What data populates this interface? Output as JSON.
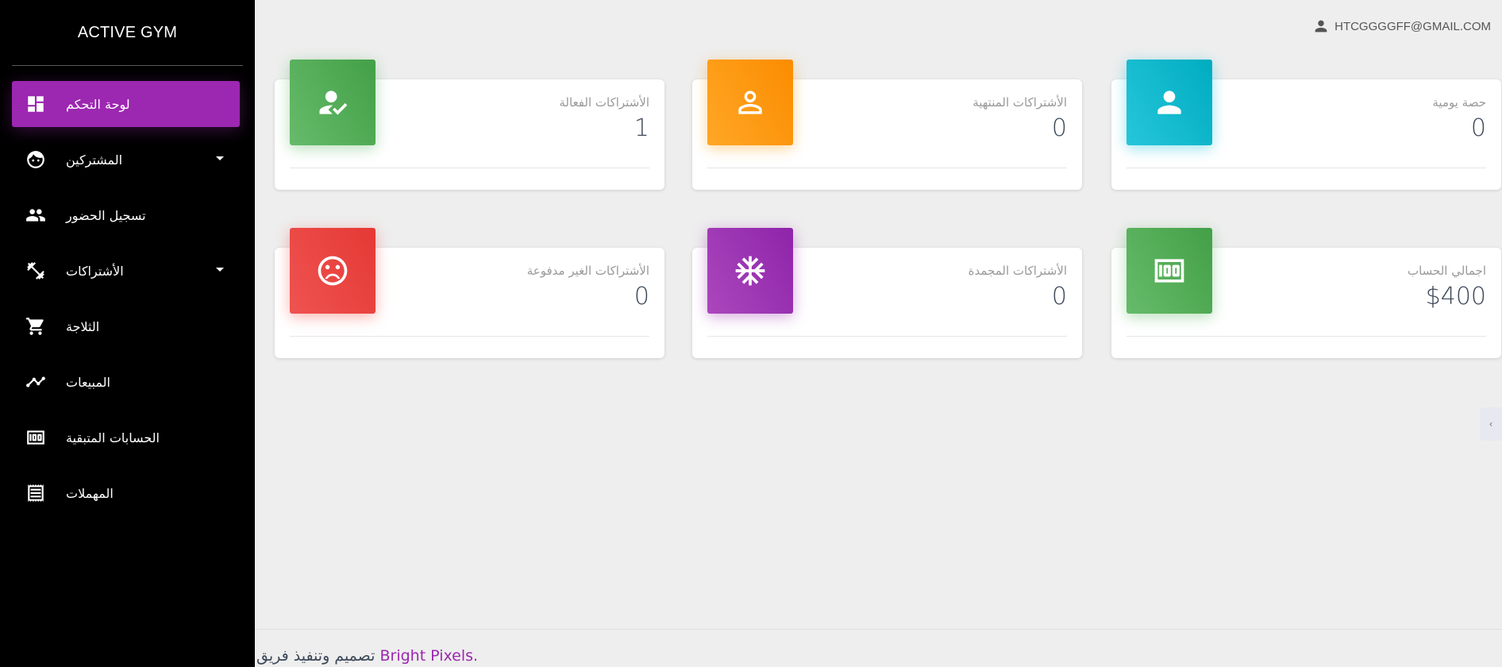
{
  "sidebar": {
    "brand": "ACTIVE GYM",
    "items": [
      {
        "label": "لوحة التحكم",
        "icon": "dashboard-icon"
      },
      {
        "label": "المشتركين",
        "icon": "face-icon"
      },
      {
        "label": "تسجيل الحضور",
        "icon": "people-icon"
      },
      {
        "label": "الأشتراكات",
        "icon": "dumbbell-icon"
      },
      {
        "label": "الثلاجة",
        "icon": "cart-icon"
      },
      {
        "label": "المبيعات",
        "icon": "trending-icon"
      },
      {
        "label": "الحسابات المتبقية",
        "icon": "money-icon"
      },
      {
        "label": "المهملات",
        "icon": "receipt-icon"
      }
    ]
  },
  "header": {
    "user_email": "HTCGGGGFF@GMAIL.COM"
  },
  "cards": [
    {
      "title": "الأشتراكات الفعالة",
      "value": "1",
      "color": "#4caf50",
      "icon": "how-to-reg-icon"
    },
    {
      "title": "الأشتراكات المنتهية",
      "value": "0",
      "color": "#ff9800",
      "icon": "person-outline-icon"
    },
    {
      "title": "حصة يومية",
      "value": "0",
      "color": "#00bcd4",
      "icon": "person-icon"
    },
    {
      "title": "الأشتراكات الغير مدفوعة",
      "value": "0",
      "color": "#f44336",
      "icon": "sad-face-icon"
    },
    {
      "title": "الأشتراكات المجمدة",
      "value": "0",
      "color": "#9c27b0",
      "icon": "snowflake-icon"
    },
    {
      "title": "اجمالي الحساب",
      "value": "$400",
      "color": "#4caf50",
      "icon": "money-icon"
    }
  ],
  "footer": {
    "prefix": "تصميم وتنفيذ فريق",
    "brand": "Bright Pixels."
  },
  "colors": {
    "accent": "#9c27b0",
    "sidebar_bg": "#000000",
    "page_bg": "#eeeeee"
  }
}
